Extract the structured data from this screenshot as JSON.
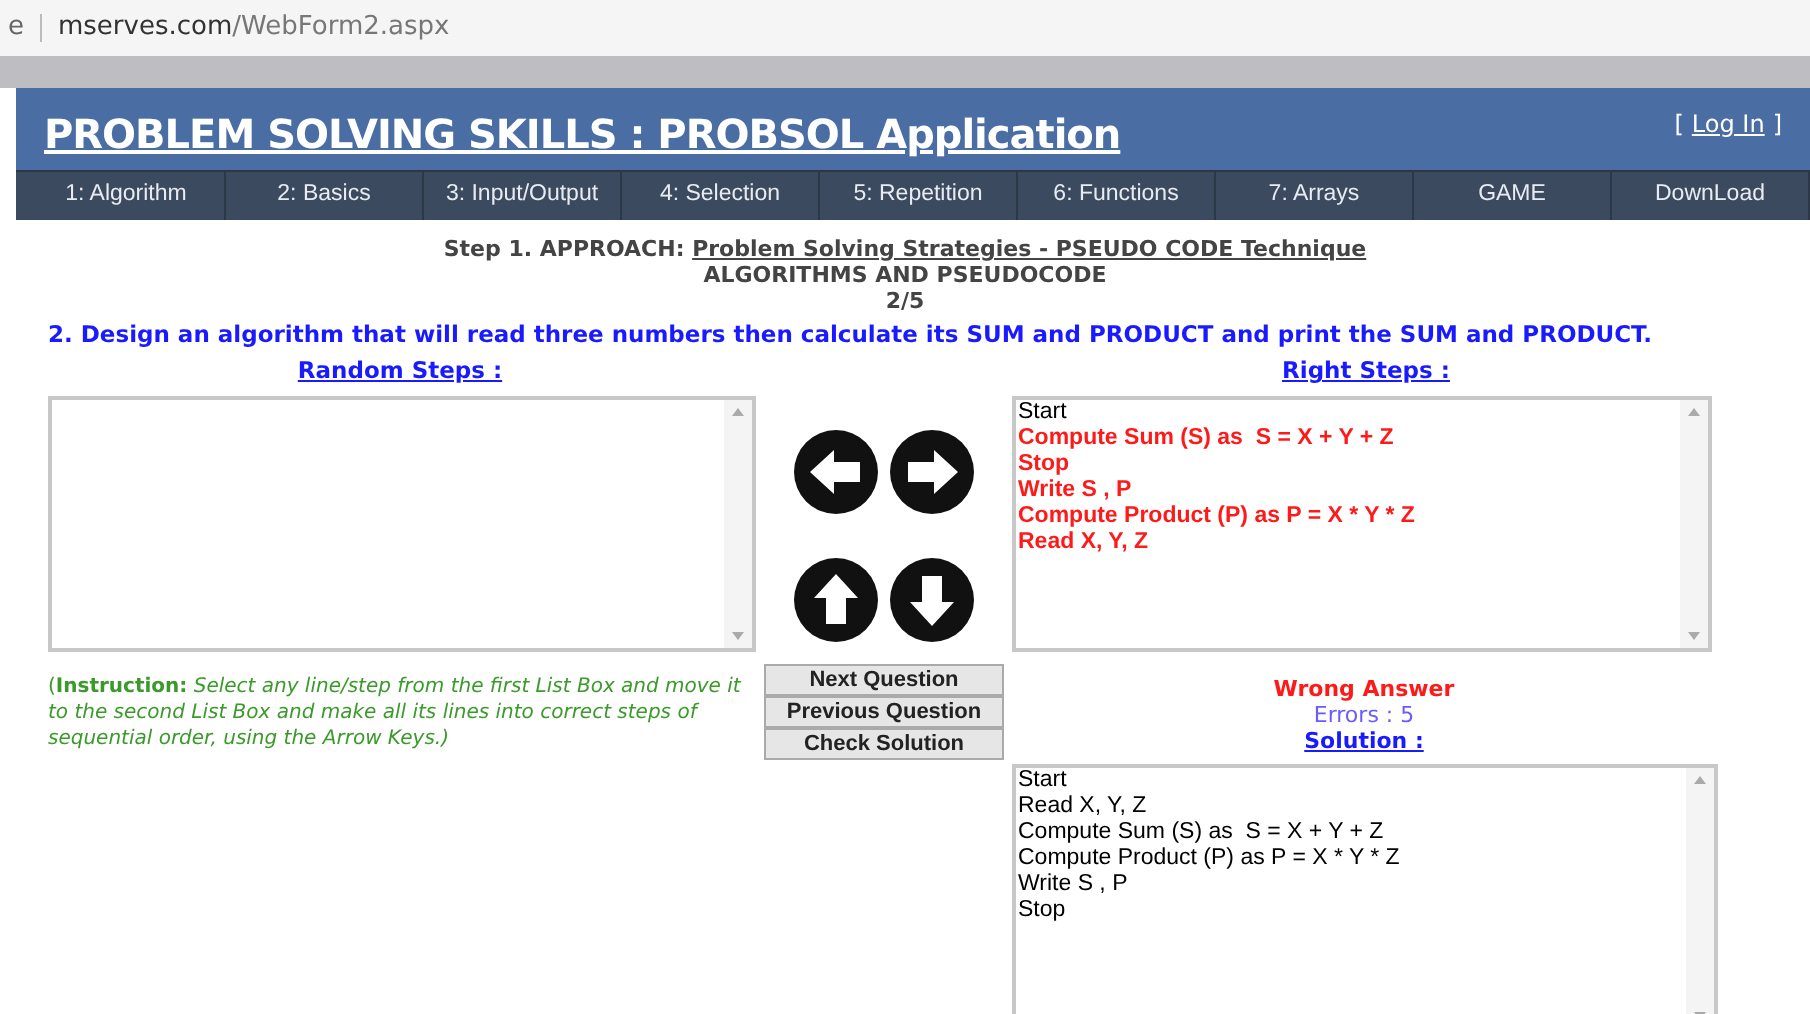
{
  "address_bar": {
    "prefix": "e",
    "url_host": "mserves.com",
    "url_path": "/WebForm2.aspx"
  },
  "header": {
    "title": "PROBLEM SOLVING SKILLS : PROBSOL Application",
    "login": "Log In",
    "login_open": "[",
    "login_close": "]"
  },
  "nav": [
    "1: Algorithm",
    "2: Basics",
    "3: Input/Output",
    "4: Selection",
    "5: Repetition",
    "6: Functions",
    "7: Arrays",
    "GAME",
    "DownLoad"
  ],
  "step": {
    "prefix": "Step 1.  APPROACH: ",
    "link": "Problem Solving Strategies - PSEUDO CODE Technique"
  },
  "subtitle": "ALGORITHMS AND PSEUDOCODE",
  "counter": "2/5",
  "question": "2. Design an algorithm that will read three numbers then calculate its SUM and PRODUCT and print the SUM and PRODUCT.",
  "random_steps": {
    "label": "Random Steps :"
  },
  "right_steps": {
    "label": "Right Steps :",
    "items": [
      {
        "text": "Start",
        "wrong": false
      },
      {
        "text": "Compute Sum (S) as  S = X + Y + Z",
        "wrong": true
      },
      {
        "text": "Stop",
        "wrong": true
      },
      {
        "text": "Write S , P",
        "wrong": true
      },
      {
        "text": "Compute Product (P) as P = X * Y * Z",
        "wrong": true
      },
      {
        "text": "Read X, Y, Z",
        "wrong": true
      }
    ]
  },
  "instruction": "(**Instruction:** *Select any line/step from the first List Box and move it to the second List Box and make all its lines into correct steps of sequential order, using the Arrow Keys.)*",
  "buttons": [
    "Next Question",
    "Previous Question",
    "Check Solution"
  ],
  "result": "Wrong Answer",
  "errors": "Errors : 5",
  "solution": {
    "label": "Solution :",
    "items": [
      "Start",
      "Read X, Y, Z",
      "Compute Sum (S) as  S = X + Y + Z",
      "Compute Product (P) as P = X * Y * Z",
      "Write S , P",
      "Stop"
    ]
  }
}
